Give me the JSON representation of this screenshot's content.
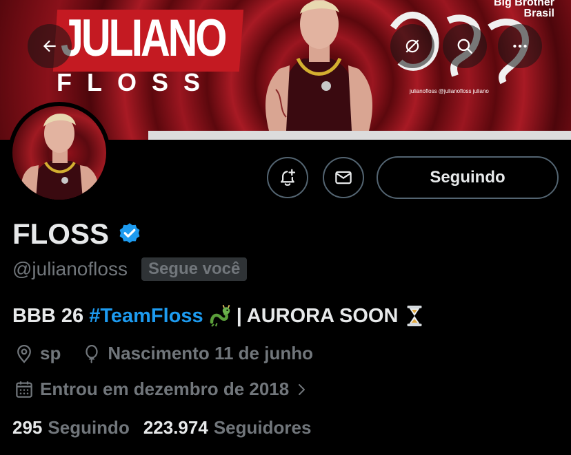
{
  "banner": {
    "title": "JULIANO",
    "subtitle": "FLOSS",
    "brand_line1": "Big Brother",
    "brand_line2": "Brasil",
    "socials": "julianofloss  @julianofloss  juliano",
    "bg_color": "#8a111a"
  },
  "actions": {
    "follow_label": "Seguindo"
  },
  "profile": {
    "display_name": "FLOSS",
    "handle": "@julianofloss",
    "follows_you": "Segue você",
    "bio_prefix": "BBB 26 ",
    "bio_hashtag": "#TeamFloss",
    "bio_suffix": "| AURORA SOON",
    "location": "sp",
    "birthday": "Nascimento 11 de junho",
    "joined": "Entrou em dezembro de 2018"
  },
  "stats": {
    "following_count": "295",
    "following_label": "Seguindo",
    "followers_count": "223.974",
    "followers_label": "Seguidores"
  },
  "colors": {
    "accent": "#1d9bf0",
    "muted": "#71767b",
    "border": "#536471"
  },
  "icons": {
    "back": "arrow-left-icon",
    "grok": "grok-icon",
    "search": "search-icon",
    "more": "more-icon",
    "notify": "bell-plus-icon",
    "message": "mail-icon",
    "verified": "verified-badge-icon",
    "location": "location-pin-icon",
    "birthday": "balloon-icon",
    "calendar": "calendar-icon",
    "chevron": "chevron-right-icon"
  }
}
